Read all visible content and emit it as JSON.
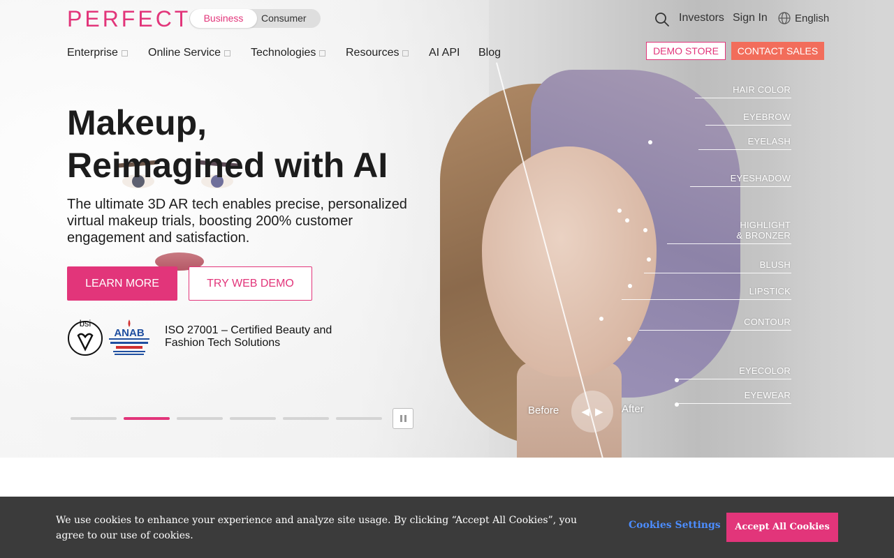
{
  "header": {
    "logo": "PERFECT",
    "audience_toggle": {
      "active": "Business",
      "other": "Consumer"
    },
    "utility": {
      "investors": "Investors",
      "sign_in": "Sign In",
      "language": "English"
    },
    "nav": [
      {
        "label": "Enterprise",
        "has_menu": true
      },
      {
        "label": "Online Service",
        "has_menu": true
      },
      {
        "label": "Technologies",
        "has_menu": true
      },
      {
        "label": "Resources",
        "has_menu": true
      },
      {
        "label": "AI API",
        "has_menu": false
      },
      {
        "label": "Blog",
        "has_menu": false
      }
    ],
    "demo_store": "DEMO STORE",
    "contact_sales": "CONTACT SALES"
  },
  "hero": {
    "headline_line1": "Makeup,",
    "headline_line2": "Reimagined with AI",
    "subtext": "The ultimate 3D AR tech enables precise, personalized virtual makeup trials, boosting 200% customer engagement and satisfaction.",
    "learn_more": "LEARN MORE",
    "try_web_demo": "TRY WEB DEMO",
    "iso_text": "ISO 27001 – Certified Beauty and Fashion Tech Solutions",
    "slides": {
      "count": 6,
      "active_index": 1
    },
    "before_label": "Before",
    "after_label": "After",
    "features": [
      "HAIR COLOR",
      "EYEBROW",
      "EYELASH",
      "EYESHADOW",
      "HIGHLIGHT",
      "& BRONZER",
      "BLUSH",
      "LIPSTICK",
      "CONTOUR",
      "EYECOLOR",
      "EYEWEAR"
    ]
  },
  "cookie": {
    "text": "We use cookies to enhance your experience and analyze site usage. By clicking “Accept All Cookies”, you agree to our use of cookies.",
    "settings": "Cookies Settings",
    "accept": "Accept All Cookies"
  },
  "colors": {
    "brand": "#e2357a",
    "contact": "#f26d5b",
    "cookie_bg": "#3b3b3b",
    "link_blue": "#4c8dff"
  }
}
